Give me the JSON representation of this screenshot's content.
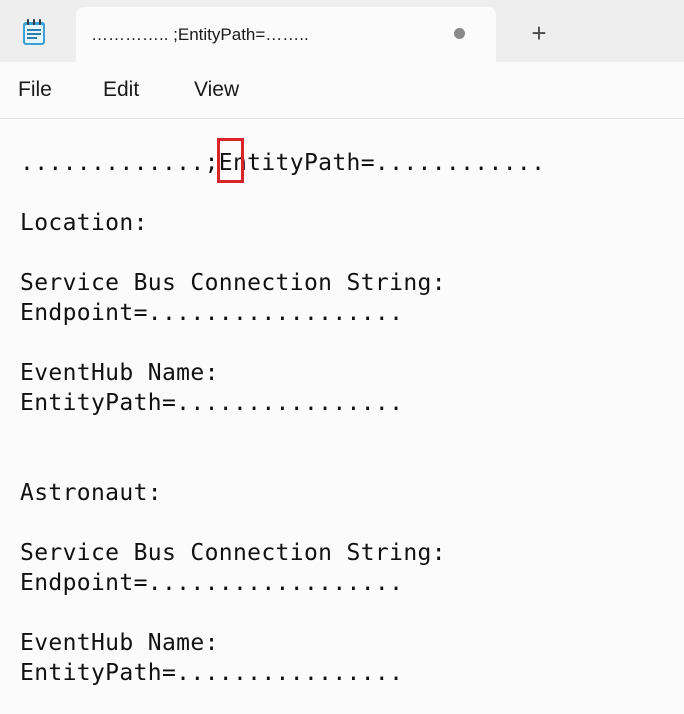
{
  "tab": {
    "title": "………….. ;EntityPath=……..",
    "new_tab_symbol": "+"
  },
  "icons": {
    "app": "notepad-icon",
    "unsaved": "unsaved-dot-icon",
    "new_tab": "plus-icon"
  },
  "menu": {
    "file": "File",
    "edit": "Edit",
    "view": "View"
  },
  "editor": {
    "lines": [
      ".............;EntityPath=............",
      "Location:",
      "Service Bus Connection String:",
      "Endpoint=..................",
      "EventHub Name:",
      "EntityPath=................",
      "Astronaut:",
      "Service Bus Connection String:",
      "Endpoint=..................",
      "EventHub Name:",
      "EntityPath=................"
    ]
  },
  "colors": {
    "highlight": "#d9232a",
    "tab_strip": "#eeeeee",
    "background": "#fbfbfb"
  }
}
